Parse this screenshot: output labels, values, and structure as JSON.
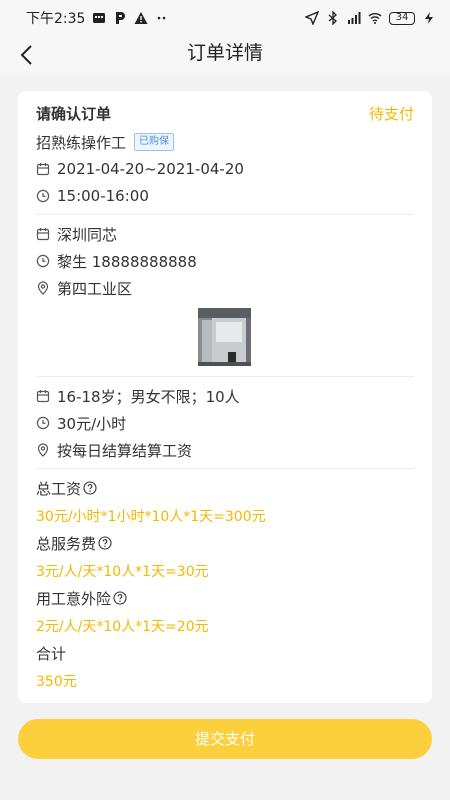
{
  "status_bar": {
    "time": "下午2:35",
    "battery": "34"
  },
  "nav": {
    "title": "订单详情"
  },
  "order": {
    "heading": "请确认订单",
    "status": "待支付",
    "job_name": "招熟练操作工",
    "insured_tag": "已购保",
    "date_range": "2021-04-20~2021-04-20",
    "time_range": "15:00-16:00",
    "company": "深圳同芯",
    "contact": "黎生 18888888888",
    "location": "第四工业区",
    "requirements": "16-18岁；男女不限；10人",
    "wage": "30元/小时",
    "settlement": "按每日结算结算工资"
  },
  "fees": {
    "total_wage_label": "总工资",
    "total_wage_value": "30元/小时*1小时*10人*1天=300元",
    "service_fee_label": "总服务费",
    "service_fee_value": "3元/人/天*10人*1天=30元",
    "insurance_label": "用工意外险",
    "insurance_value": "2元/人/天*10人*1天=20元",
    "sum_label": "合计",
    "sum_value": "350元"
  },
  "actions": {
    "submit_label": "提交支付"
  },
  "colors": {
    "accent": "#f5b800",
    "button": "#fcd03d",
    "tag": "#4a90d9"
  }
}
